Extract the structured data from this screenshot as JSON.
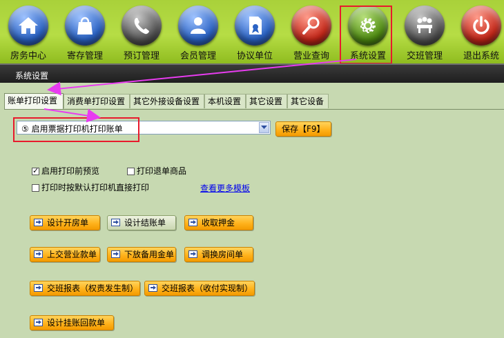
{
  "toolbar": {
    "items": [
      {
        "label": "房务中心",
        "icon": "house-icon",
        "color": "#2b63c4"
      },
      {
        "label": "寄存管理",
        "icon": "bag-icon",
        "color": "#2b63c4"
      },
      {
        "label": "预订管理",
        "icon": "phone-icon",
        "color": "#555555"
      },
      {
        "label": "会员管理",
        "icon": "person-icon",
        "color": "#2b63c4"
      },
      {
        "label": "协议单位",
        "icon": "certificate-icon",
        "color": "#2b63c4"
      },
      {
        "label": "营业查询",
        "icon": "magnifier-icon",
        "color": "#c4281a"
      },
      {
        "label": "系统设置",
        "icon": "gear-icon",
        "color": "#4f8b12"
      },
      {
        "label": "交班管理",
        "icon": "meeting-icon",
        "color": "#555555"
      },
      {
        "label": "退出系统",
        "icon": "power-icon",
        "color": "#c4281a"
      }
    ]
  },
  "window": {
    "title": "系统设置"
  },
  "tabs": [
    {
      "label": "账单打印设置",
      "active": true
    },
    {
      "label": "消费单打印设置",
      "active": false
    },
    {
      "label": "其它外接设备设置",
      "active": false
    },
    {
      "label": "本机设置",
      "active": false
    },
    {
      "label": "其它设置",
      "active": false
    },
    {
      "label": "其它设备",
      "active": false
    }
  ],
  "print_mode": {
    "selected": "⑤  启用票据打印机打印账单"
  },
  "save_label": "保存【F9】",
  "options": {
    "preview_before_print": {
      "label": "启用打印前预览",
      "checked": true
    },
    "print_refund_items": {
      "label": "打印退单商品",
      "checked": false
    },
    "default_printer_direct": {
      "label": "打印时按默认打印机直接打印",
      "checked": false
    }
  },
  "more_templates_link": "查看更多模板",
  "buttons": [
    {
      "label": "设计开房单"
    },
    {
      "label": "设计结账单",
      "pressed": true
    },
    {
      "label": "收取押金"
    },
    {
      "label": "上交营业款单"
    },
    {
      "label": "下放备用金单"
    },
    {
      "label": "调换房间单"
    },
    {
      "label": "交班报表（权责发生制）"
    },
    {
      "label": "交班报表（收付实现制）"
    },
    {
      "label": "设计挂账回款单"
    }
  ],
  "accent_colors": {
    "highlight_box": "#e8192c",
    "arrow": "#e83cf0"
  }
}
